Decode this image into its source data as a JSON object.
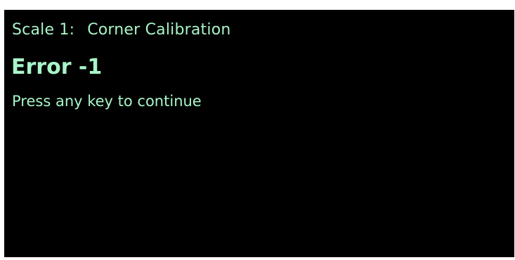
{
  "screen": {
    "scale_label": "Scale 1:",
    "mode_title": "Corner Calibration",
    "error_text": "Error -1",
    "prompt_text": "Press any key to continue"
  },
  "colors": {
    "background": "#000000",
    "text": "#a8f5c8",
    "page": "#ffffff"
  }
}
